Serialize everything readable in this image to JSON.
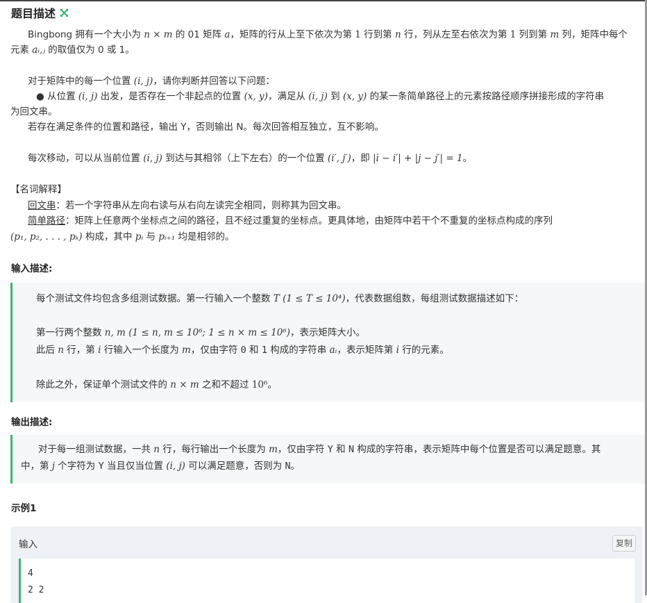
{
  "title": "题目描述",
  "desc": {
    "l1a": "Bingbong 拥有一个大小为 ",
    "l1b": " 的 01 矩阵 ",
    "l1c": "，矩阵的行从上至下依次为第 ",
    "l1d": " 行到第 ",
    "l1e": " 行，列从左至右依次为第 ",
    "l1f": " 列到第 ",
    "l1g": " 列，矩阵中每个",
    "l2a": "元素 ",
    "l2b": " 的取值仅为 0 或 1。",
    "l3a": "对于矩阵中的每一个位置 ",
    "l3b": "，请你判断并回答以下问题：",
    "l4a": "● 从位置 ",
    "l4b": " 出发，是否存在一个非起点的位置 ",
    "l4c": "，满足从 ",
    "l4d": " 到 ",
    "l4e": " 的某一条简单路径上的元素按路径顺序拼接形成的字符串",
    "l5": "为回文串。",
    "l6": "若存在满足条件的位置和路径，输出 Y，否则输出 N。每次回答相互独立，互不影响。",
    "l7a": "每次移动，可以从当前位置 ",
    "l7b": " 到达与其相邻（上下左右）的一个位置 ",
    "l7c": "，即 ",
    "l7d": "。"
  },
  "glossary": {
    "heading": "【名词解释】",
    "g1_term": "回文串",
    "g1_text": "：若一个字符串从左向右读与从右向左读完全相同，则称其为回文串。",
    "g2_term": "简单路径",
    "g2_text": "：矩阵上任意两个坐标点之间的路径，且不经过重复的坐标点。更具体地，由矩阵中若干个不重复的坐标点构成的序列",
    "g3a": " 构成，其中 ",
    "g3b": " 与 ",
    "g3c": " 均是相邻的。"
  },
  "input_section": {
    "heading": "输入描述:",
    "i1a": "每个测试文件均包含多组测试数据。第一行输入一个整数 ",
    "i1b": "，代表数据组数，每组测试数据描述如下：",
    "i2a": "第一行两个整数 ",
    "i2b": "，表示矩阵大小。",
    "i3a": "此后 ",
    "i3b": " 行，第 ",
    "i3c": " 行输入一个长度为 ",
    "i3d": "，仅由字符 ",
    "i3e": " 和 ",
    "i3f": " 构成的字符串 ",
    "i3g": "，表示矩阵第 ",
    "i3h": " 行的元素。",
    "i4a": "除此之外，保证单个测试文件的 ",
    "i4b": " 之和不超过 ",
    "i4c": "。"
  },
  "output_section": {
    "heading": "输出描述:",
    "o1a": "对于每一组测试数据，一共 ",
    "o1b": " 行，每行输出一个长度为 ",
    "o1c": "，仅由字符 ",
    "o1d": " 和 ",
    "o1e": " 构成的字符串，表示矩阵中每个位置是否可以满足题意。其",
    "o2a": "中，第 ",
    "o2b": " 个字符为 ",
    "o2c": " 当且仅当位置 ",
    "o2d": " 可以满足题意，否则为 ",
    "o2e": "。"
  },
  "example": {
    "heading": "示例1",
    "label": "输入",
    "copy": "复制",
    "lines": [
      "4",
      "2 2"
    ]
  },
  "math": {
    "nxm": "n × m",
    "a": "a",
    "one": "1",
    "n": "n",
    "m": "m",
    "aij": "aᵢ,ⱼ",
    "ij": "(i, j)",
    "xy": "(x, y)",
    "ipjp": "(i′, j′)",
    "absdist": "|i − i′| + |j − j′| = 1",
    "seq": "(p₁, p₂, . . . , pₖ)",
    "pi": "pᵢ",
    "pi1": "pᵢ₊₁",
    "T": "T",
    "Trange": "(1 ≤ T ≤ 10⁴)",
    "nm": "n, m",
    "nmrange": "(1 ≤ n, m ≤ 10⁶; 1 ≤ n × m ≤ 10⁶)",
    "i": "i",
    "ai": "aᵢ",
    "c0": "0",
    "c1": "1",
    "pow6": "10⁶",
    "j": "j",
    "Y": "Y",
    "N": "N"
  }
}
